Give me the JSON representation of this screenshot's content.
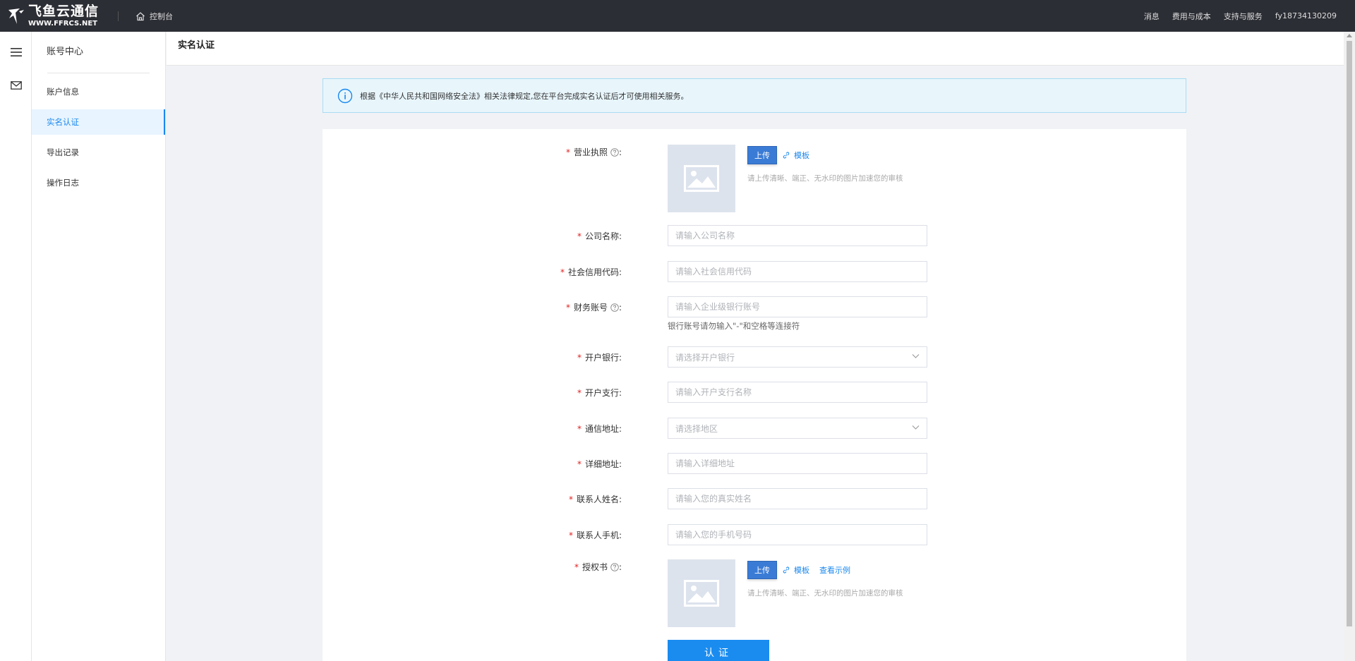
{
  "topbar": {
    "logo_cn": "飞鱼云通信",
    "logo_en": "WWW.FFRCS.NET",
    "console": "控制台",
    "messages": "消息",
    "billing": "费用与成本",
    "support": "支持与服务",
    "user": "fy18734130209"
  },
  "sidebar": {
    "title": "账号中心",
    "items": [
      {
        "label": "账户信息"
      },
      {
        "label": "实名认证"
      },
      {
        "label": "导出记录"
      },
      {
        "label": "操作日志"
      }
    ]
  },
  "page": {
    "title": "实名认证",
    "notice": "根据《中华人民共和国网络安全法》相关法律规定,您在平台完成实名认证后才可使用相关服务。"
  },
  "form": {
    "license": {
      "label": "营业执照",
      "upload": "上传",
      "template": "模板",
      "hint": "请上传清晰、端正、无水印的图片加速您的审核"
    },
    "company": {
      "label": "公司名称:",
      "placeholder": "请输入公司名称"
    },
    "credit": {
      "label": "社会信用代码:",
      "placeholder": "请输入社会信用代码"
    },
    "account": {
      "label": "财务账号",
      "placeholder": "请输入企业级银行账号",
      "hint": "银行账号请勿输入\"-\"和空格等连接符"
    },
    "bank": {
      "label": "开户银行:",
      "placeholder": "请选择开户银行"
    },
    "branch": {
      "label": "开户支行:",
      "placeholder": "请输入开户支行名称"
    },
    "region": {
      "label": "通信地址:",
      "placeholder": "请选择地区"
    },
    "address": {
      "label": "详细地址:",
      "placeholder": "请输入详细地址"
    },
    "contact": {
      "label": "联系人姓名:",
      "placeholder": "请输入您的真实姓名"
    },
    "phone": {
      "label": "联系人手机:",
      "placeholder": "请输入您的手机号码"
    },
    "auth": {
      "label": "授权书",
      "upload": "上传",
      "template": "模板",
      "example": "查看示例",
      "hint": "请上传清晰、端正、无水印的图片加速您的审核"
    },
    "colon": ":",
    "submit": "认证"
  },
  "colors": {
    "topbar": "#2c2e35",
    "accent": "#1a88ee",
    "required": "#e02020"
  }
}
